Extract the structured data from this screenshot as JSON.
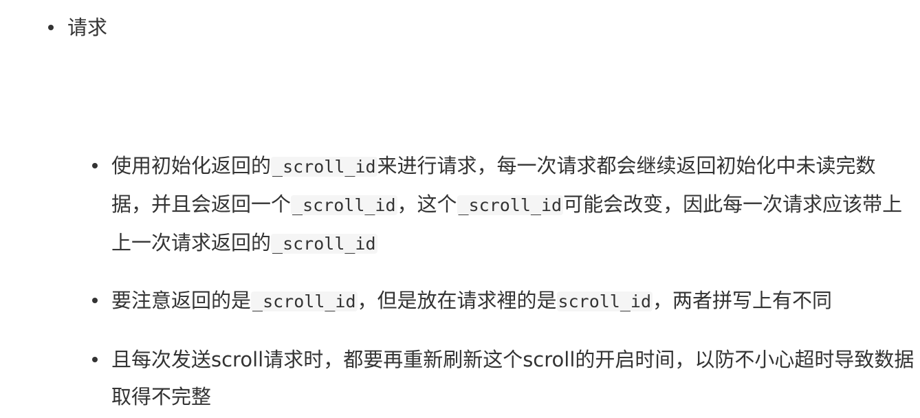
{
  "list": {
    "top_item": "请求",
    "items": [
      {
        "parts": [
          "使用初始化返回的",
          "_scroll_id",
          "来进行请求，每一次请求都会继续返回初始化中未读完数据，并且会返回一个",
          "_scroll_id",
          "，这个",
          "_scroll_id",
          "可能会改变，因此每一次请求应该带上上一次请求返回的",
          "_scroll_id"
        ]
      },
      {
        "parts": [
          "要注意返回的是",
          "_scroll_id",
          "，但是放在请求裡的是",
          "scroll_id",
          "，两者拼写上有不同"
        ]
      },
      {
        "parts": [
          "且每次发送scroll请求时，都要再重新刷新这个scroll的开启时间，以防不小心超时导致数据取得不完整"
        ]
      }
    ]
  }
}
